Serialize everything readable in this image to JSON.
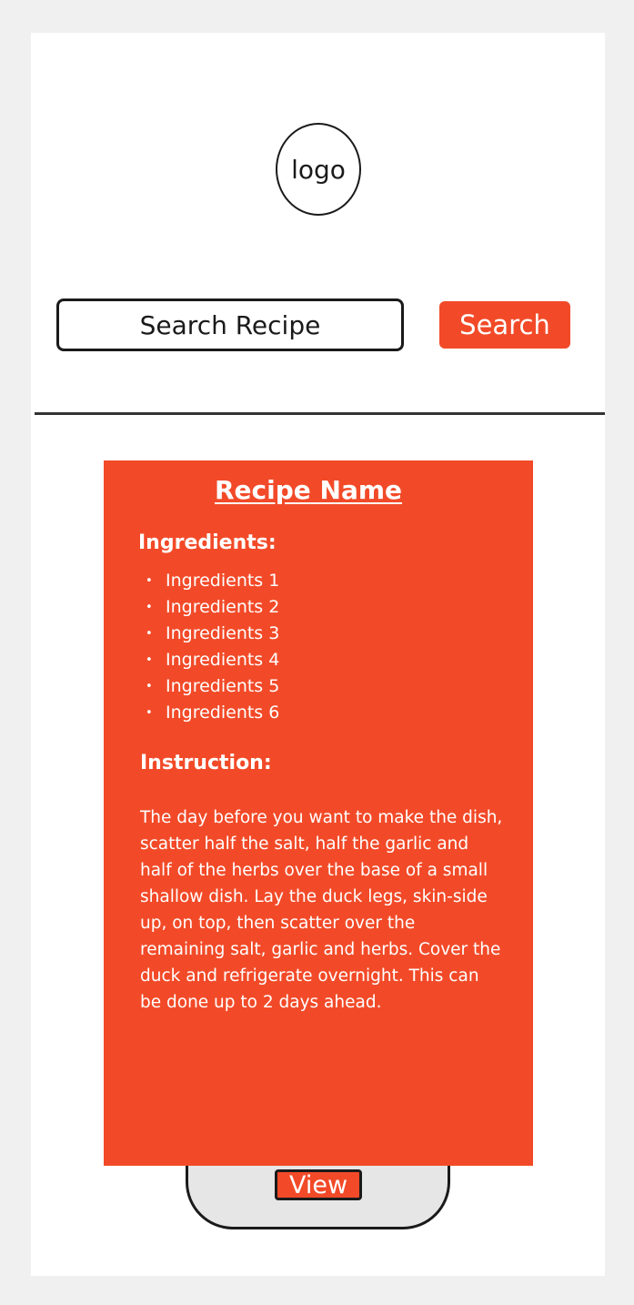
{
  "header": {
    "logo_text": "logo"
  },
  "search": {
    "placeholder": "Search Recipe",
    "button_label": "Search"
  },
  "recipe": {
    "name": "Recipe Name",
    "ingredients_heading": "Ingredients:",
    "ingredients": [
      "Ingredients 1",
      "Ingredients 2",
      "Ingredients 3",
      "Ingredients 4",
      "Ingredients 5",
      "Ingredients 6"
    ],
    "instruction_heading": "Instruction:",
    "instruction_text": "The day before you want to make the dish, scatter half the salt, half the garlic and half of the herbs over the base of a small shallow dish. Lay the duck legs, skin-side up, on top, then scatter over the remaining salt, garlic and herbs. Cover the duck and refrigerate overnight. This can be done up to 2 days ahead."
  },
  "actions": {
    "view_label": "View"
  },
  "colors": {
    "accent": "#f24a28",
    "page_background": "#f0f0f0",
    "tray": "#e6e6e6"
  }
}
